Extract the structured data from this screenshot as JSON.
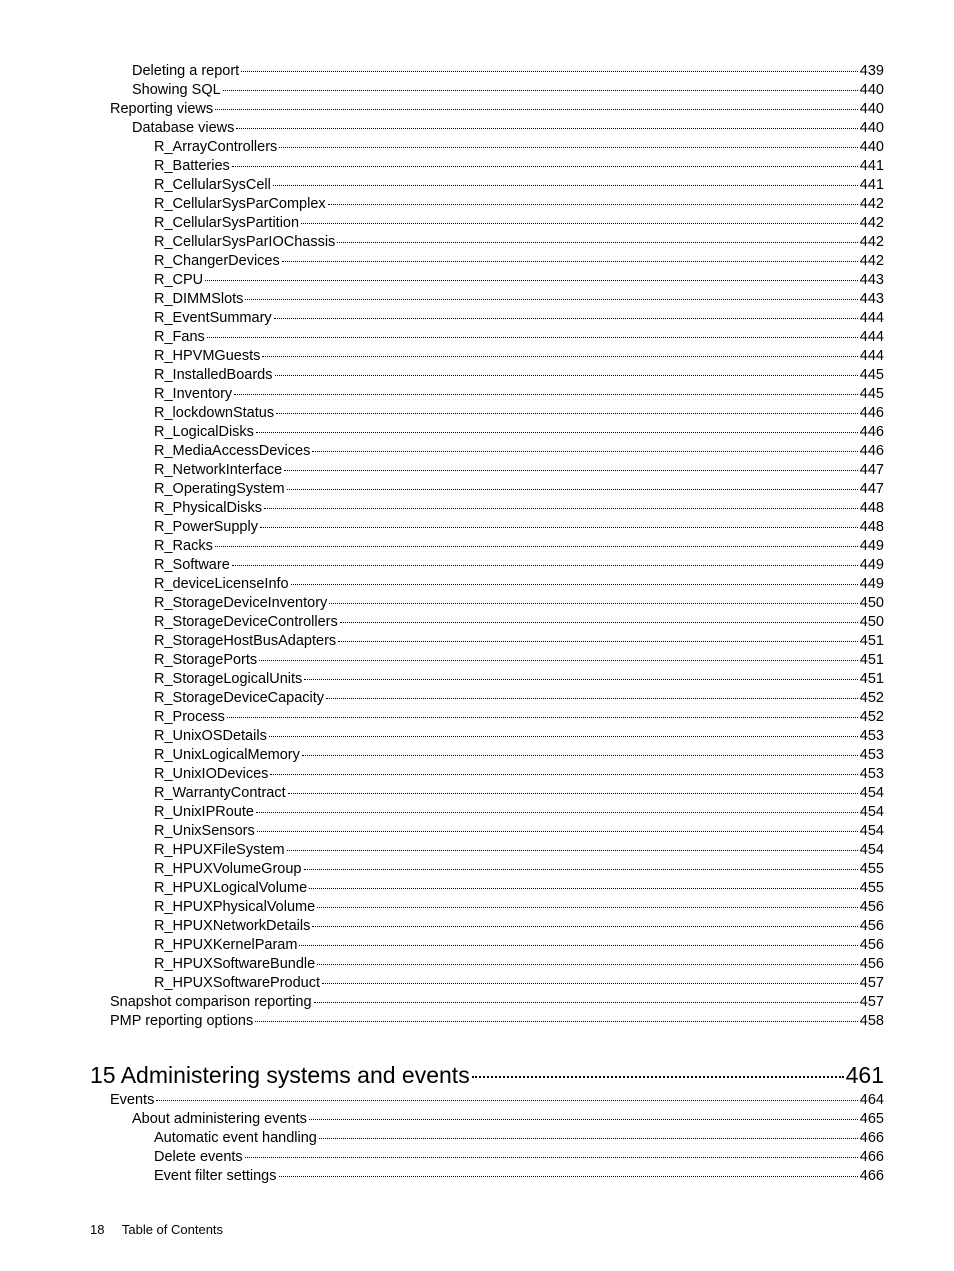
{
  "toc": [
    {
      "indent": 2,
      "title": "Deleting a report",
      "page": "439"
    },
    {
      "indent": 2,
      "title": "Showing SQL",
      "page": "440"
    },
    {
      "indent": 1,
      "title": "Reporting views",
      "page": "440"
    },
    {
      "indent": 2,
      "title": "Database views",
      "page": "440"
    },
    {
      "indent": 3,
      "title": "R_ArrayControllers",
      "page": "440"
    },
    {
      "indent": 3,
      "title": "R_Batteries",
      "page": "441"
    },
    {
      "indent": 3,
      "title": "R_CellularSysCell",
      "page": "441"
    },
    {
      "indent": 3,
      "title": "R_CellularSysParComplex",
      "page": "442"
    },
    {
      "indent": 3,
      "title": "R_CellularSysPartition",
      "page": "442"
    },
    {
      "indent": 3,
      "title": "R_CellularSysParIOChassis",
      "page": "442"
    },
    {
      "indent": 3,
      "title": "R_ChangerDevices",
      "page": "442"
    },
    {
      "indent": 3,
      "title": "R_CPU",
      "page": "443"
    },
    {
      "indent": 3,
      "title": "R_DIMMSlots",
      "page": "443"
    },
    {
      "indent": 3,
      "title": "R_EventSummary",
      "page": "444"
    },
    {
      "indent": 3,
      "title": "R_Fans",
      "page": "444"
    },
    {
      "indent": 3,
      "title": "R_HPVMGuests",
      "page": "444"
    },
    {
      "indent": 3,
      "title": "R_InstalledBoards",
      "page": "445"
    },
    {
      "indent": 3,
      "title": "R_Inventory",
      "page": "445"
    },
    {
      "indent": 3,
      "title": "R_lockdownStatus",
      "page": "446"
    },
    {
      "indent": 3,
      "title": "R_LogicalDisks",
      "page": "446"
    },
    {
      "indent": 3,
      "title": "R_MediaAccessDevices",
      "page": "446"
    },
    {
      "indent": 3,
      "title": "R_NetworkInterface",
      "page": "447"
    },
    {
      "indent": 3,
      "title": "R_OperatingSystem",
      "page": "447"
    },
    {
      "indent": 3,
      "title": "R_PhysicalDisks",
      "page": "448"
    },
    {
      "indent": 3,
      "title": "R_PowerSupply",
      "page": "448"
    },
    {
      "indent": 3,
      "title": "R_Racks",
      "page": "449"
    },
    {
      "indent": 3,
      "title": "R_Software",
      "page": "449"
    },
    {
      "indent": 3,
      "title": "R_deviceLicenseInfo",
      "page": "449"
    },
    {
      "indent": 3,
      "title": "R_StorageDeviceInventory",
      "page": "450"
    },
    {
      "indent": 3,
      "title": "R_StorageDeviceControllers",
      "page": "450"
    },
    {
      "indent": 3,
      "title": "R_StorageHostBusAdapters",
      "page": "451"
    },
    {
      "indent": 3,
      "title": "R_StoragePorts",
      "page": "451"
    },
    {
      "indent": 3,
      "title": "R_StorageLogicalUnits",
      "page": "451"
    },
    {
      "indent": 3,
      "title": "R_StorageDeviceCapacity",
      "page": "452"
    },
    {
      "indent": 3,
      "title": "R_Process",
      "page": "452"
    },
    {
      "indent": 3,
      "title": "R_UnixOSDetails",
      "page": "453"
    },
    {
      "indent": 3,
      "title": "R_UnixLogicalMemory",
      "page": "453"
    },
    {
      "indent": 3,
      "title": "R_UnixIODevices",
      "page": "453"
    },
    {
      "indent": 3,
      "title": "R_WarrantyContract",
      "page": "454"
    },
    {
      "indent": 3,
      "title": "R_UnixIPRoute",
      "page": "454"
    },
    {
      "indent": 3,
      "title": "R_UnixSensors",
      "page": "454"
    },
    {
      "indent": 3,
      "title": "R_HPUXFileSystem",
      "page": "454"
    },
    {
      "indent": 3,
      "title": "R_HPUXVolumeGroup",
      "page": "455"
    },
    {
      "indent": 3,
      "title": "R_HPUXLogicalVolume",
      "page": "455"
    },
    {
      "indent": 3,
      "title": "R_HPUXPhysicalVolume",
      "page": "456"
    },
    {
      "indent": 3,
      "title": "R_HPUXNetworkDetails",
      "page": "456"
    },
    {
      "indent": 3,
      "title": "R_HPUXKernelParam",
      "page": "456"
    },
    {
      "indent": 3,
      "title": "R_HPUXSoftwareBundle",
      "page": "456"
    },
    {
      "indent": 3,
      "title": "R_HPUXSoftwareProduct",
      "page": "457"
    },
    {
      "indent": 1,
      "title": "Snapshot comparison reporting",
      "page": "457"
    },
    {
      "indent": 1,
      "title": "PMP reporting options",
      "page": "458"
    }
  ],
  "chapter": {
    "title": "15 Administering systems and events",
    "page": "461"
  },
  "toc2": [
    {
      "indent": 0,
      "title": "Events",
      "page": "464"
    },
    {
      "indent": 1,
      "title": "About administering events",
      "page": "465"
    },
    {
      "indent": 2,
      "title": "Automatic event handling",
      "page": "466"
    },
    {
      "indent": 2,
      "title": "Delete events",
      "page": "466"
    },
    {
      "indent": 2,
      "title": "Event filter settings",
      "page": "466"
    }
  ],
  "footer": {
    "pagenum": "18",
    "label": "Table of Contents"
  }
}
